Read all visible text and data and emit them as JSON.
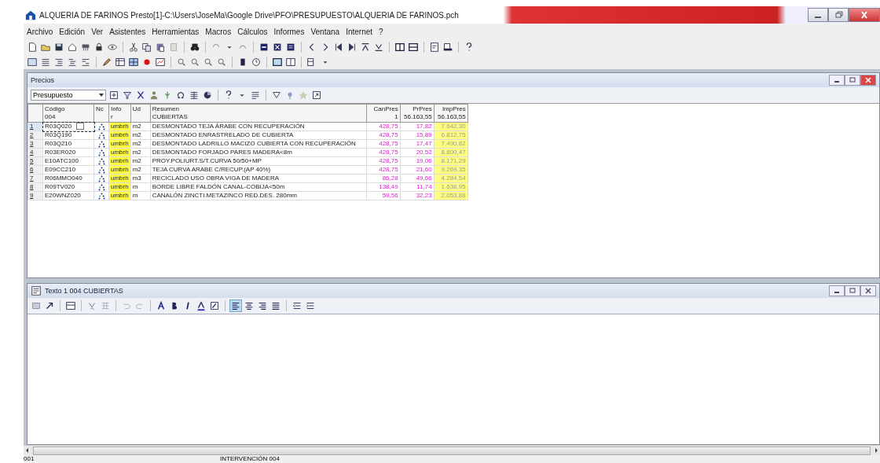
{
  "window": {
    "app_name": "ALQUERIA DE FARINOS",
    "title": "Presto[1]-C:\\Users\\JoseMa\\Google Drive\\PFO\\PRESUPUESTO\\ALQUERIA DE FARINOS.pch"
  },
  "menu": [
    "Archivo",
    "Edición",
    "Ver",
    "Asistentes",
    "Herramientas",
    "Macros",
    "Cálculos",
    "Informes",
    "Ventana",
    "Internet",
    "?"
  ],
  "precios_window": {
    "title": "Precios",
    "view_select": "Presupuesto",
    "columns": [
      {
        "label": "Código",
        "sub": "004"
      },
      {
        "label": "Nc"
      },
      {
        "label": "Info",
        "sub": "r"
      },
      {
        "label": "Ud"
      },
      {
        "label": "Resumen",
        "sub": "CUBIERTAS"
      },
      {
        "label": "CanPres",
        "sub": "1"
      },
      {
        "label": "PrPres",
        "sub": "56.163,55"
      },
      {
        "label": "ImpPres",
        "sub": "56.163,55"
      }
    ],
    "rows": [
      {
        "n": "1",
        "code": "R03Q020",
        "info": "umbrh",
        "ud": "m2",
        "resumen": "DESMONTADO TEJA ÁRABE CON RECUPERACIÓN",
        "can": "428,75",
        "pr": "17,82",
        "imp": "7.642,30",
        "selected": true
      },
      {
        "n": "2",
        "code": "R03Q190",
        "info": "umbrh",
        "ud": "m2",
        "resumen": "DESMONTADO ENRASTRELADO DE CUBIERTA",
        "can": "428,75",
        "pr": "15,89",
        "imp": "6.812,75",
        "selected": false
      },
      {
        "n": "3",
        "code": "R03Q210",
        "info": "umbrh",
        "ud": "m2",
        "resumen": "DESMONTADO LADRILLO MACIZO CUBIERTA CON RECUPERACIÓN",
        "can": "428,75",
        "pr": "17,47",
        "imp": "7.490,82",
        "selected": false
      },
      {
        "n": "4",
        "code": "R03ER020",
        "info": "umbrh",
        "ud": "m2",
        "resumen": "DESMONTADO FORJADO PARES MADERA<8m",
        "can": "428,75",
        "pr": "20,52",
        "imp": "8.800,47",
        "selected": false
      },
      {
        "n": "5",
        "code": "E10ATC100",
        "info": "umbrh",
        "ud": "m2",
        "resumen": "PROY.POLIURT.S/T.CURVA 50/50+MP",
        "can": "428,75",
        "pr": "19,06",
        "imp": "8.171,29",
        "selected": false
      },
      {
        "n": "6",
        "code": "E09CC210",
        "info": "umbrh",
        "ud": "m2",
        "resumen": "TEJA CURVA ARABE C/RECUP.(AP 40%)",
        "can": "428,75",
        "pr": "21,60",
        "imp": "9.269,35",
        "selected": false
      },
      {
        "n": "7",
        "code": "R06MMO040",
        "info": "umbrh",
        "ud": "m3",
        "resumen": "RECICLADO USO OBRA VIGA DE MADERA",
        "can": "86,28",
        "pr": "49,66",
        "imp": "4.284,54",
        "selected": false
      },
      {
        "n": "8",
        "code": "R09TV020",
        "info": "umbrh",
        "ud": "m",
        "resumen": "BORDE LIBRE FALDÓN CANAL-COBIJA<50m",
        "can": "138,49",
        "pr": "11,74",
        "imp": "1.638,95",
        "selected": false
      },
      {
        "n": "9",
        "code": "E20WNZ020",
        "info": "umbrh",
        "ud": "m",
        "resumen": "CANALÓN ZINCTI.METAZINCO  RED.DES. 280mm",
        "can": "59,56",
        "pr": "32,23",
        "imp": "2.053,88",
        "selected": false
      }
    ]
  },
  "texto_window": {
    "title": "Texto 1 004 CUBIERTAS"
  },
  "status_bar": [
    "001",
    "INTERVENCIÓN 004"
  ]
}
